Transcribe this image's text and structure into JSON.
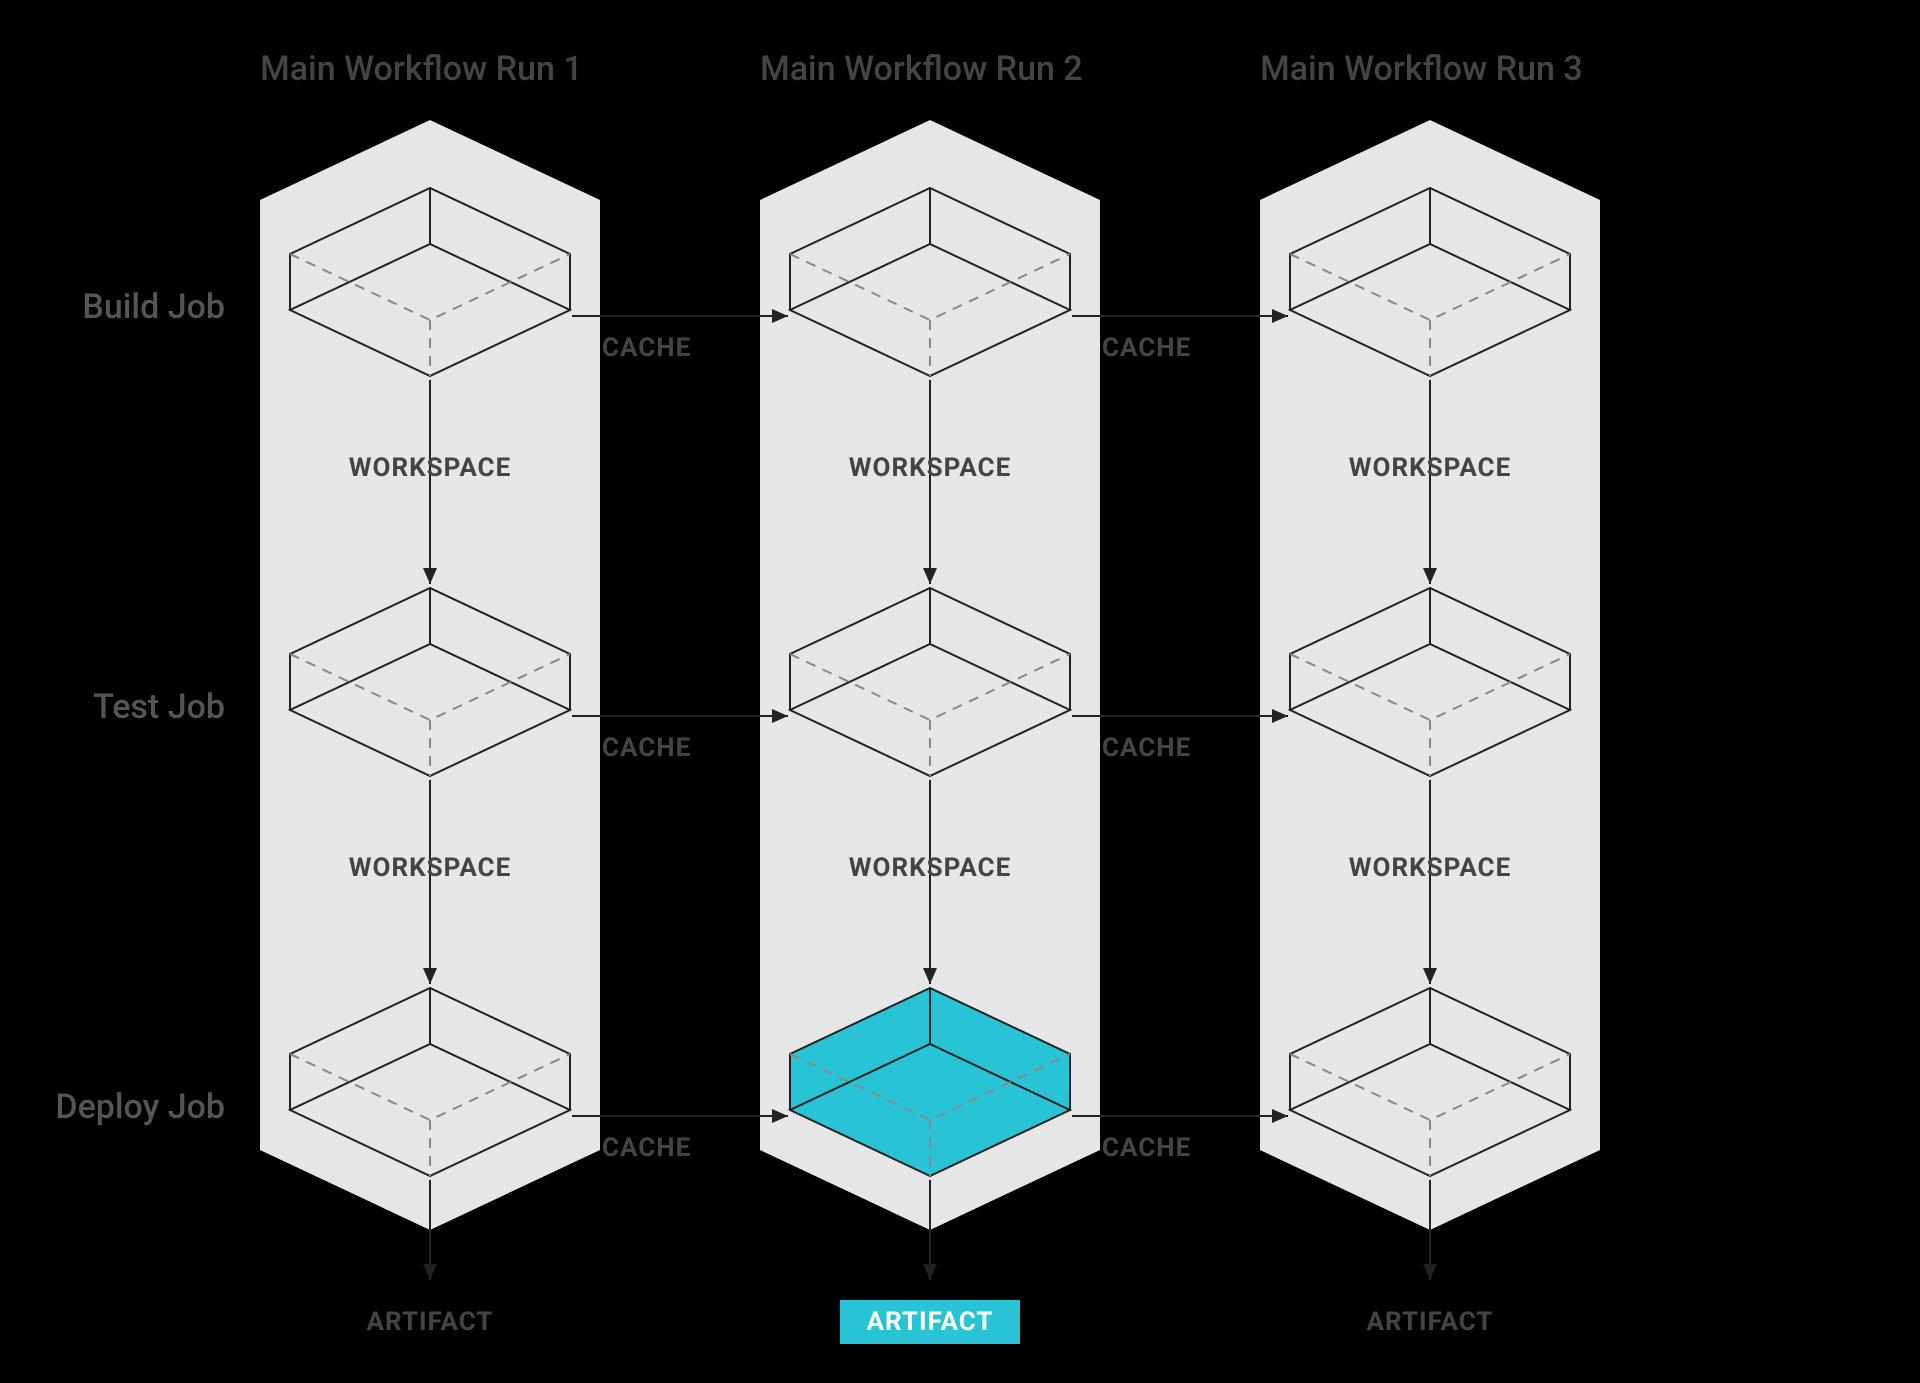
{
  "columns": [
    {
      "title": "Main Workflow Run 1",
      "artifact": "ARTIFACT",
      "artifact_highlighted": false
    },
    {
      "title": "Main Workflow Run 2",
      "artifact": "ARTIFACT",
      "artifact_highlighted": true
    },
    {
      "title": "Main Workflow Run 3",
      "artifact": "ARTIFACT",
      "artifact_highlighted": false
    }
  ],
  "rows": [
    {
      "label": "Build Job"
    },
    {
      "label": "Test Job"
    },
    {
      "label": "Deploy Job"
    }
  ],
  "workspace_label": "WORKSPACE",
  "cache_label": "CACHE",
  "highlighted_box": {
    "col": 1,
    "row": 2
  },
  "colors": {
    "bg": "#000",
    "panel": "#e6e6e6",
    "line": "#222",
    "dashed": "#888",
    "highlight": "#29c3d6"
  }
}
